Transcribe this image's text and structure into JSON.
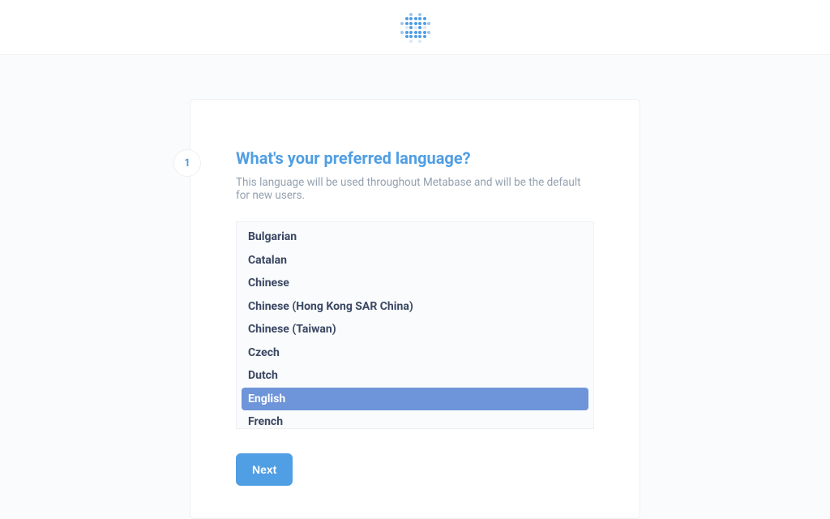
{
  "step": {
    "number": "1"
  },
  "heading": "What's your preferred language?",
  "description": "This language will be used throughout Metabase and will be the default for new users.",
  "languages": [
    {
      "label": "Bulgarian",
      "selected": false
    },
    {
      "label": "Catalan",
      "selected": false
    },
    {
      "label": "Chinese",
      "selected": false
    },
    {
      "label": "Chinese (Hong Kong SAR China)",
      "selected": false
    },
    {
      "label": "Chinese (Taiwan)",
      "selected": false
    },
    {
      "label": "Czech",
      "selected": false
    },
    {
      "label": "Dutch",
      "selected": false
    },
    {
      "label": "English",
      "selected": true
    },
    {
      "label": "French",
      "selected": false
    }
  ],
  "buttons": {
    "next": "Next"
  }
}
